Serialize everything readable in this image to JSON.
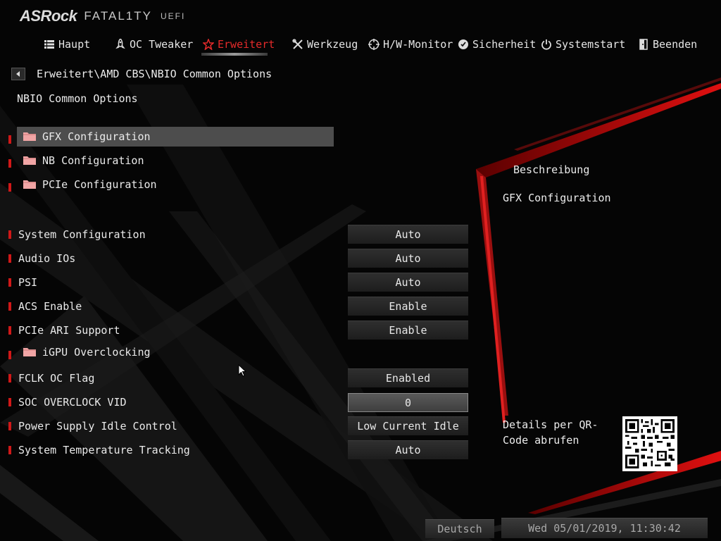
{
  "header": {
    "brand": "ASRock",
    "product": "FATAL1TY",
    "mode": "UEFI"
  },
  "nav": {
    "items": [
      {
        "label": "Haupt",
        "icon": "list-icon"
      },
      {
        "label": "OC Tweaker",
        "icon": "rocket-icon"
      },
      {
        "label": "Erweitert",
        "icon": "star-icon",
        "active": true
      },
      {
        "label": "Werkzeug",
        "icon": "tools-icon"
      },
      {
        "label": "H/W-Monitor",
        "icon": "crosshair-icon"
      },
      {
        "label": "Sicherheit",
        "icon": "shield-icon"
      },
      {
        "label": "Systemstart",
        "icon": "power-icon"
      },
      {
        "label": "Beenden",
        "icon": "exit-door-icon"
      }
    ]
  },
  "breadcrumb": "Erweitert\\AMD CBS\\NBIO Common Options",
  "page_title": "NBIO Common Options",
  "submenus": [
    {
      "label": "GFX Configuration",
      "selected": true
    },
    {
      "label": "NB Configuration"
    },
    {
      "label": "PCIe Configuration"
    }
  ],
  "settings": [
    {
      "label": "System Configuration",
      "value": "Auto"
    },
    {
      "label": "Audio IOs",
      "value": "Auto"
    },
    {
      "label": "PSI",
      "value": "Auto"
    },
    {
      "label": "ACS Enable",
      "value": "Enable"
    },
    {
      "label": "PCIe ARI Support",
      "value": "Enable"
    },
    {
      "label": "iGPU Overclocking",
      "submenu": true
    },
    {
      "label": "FCLK OC Flag",
      "value": "Enabled"
    },
    {
      "label": "SOC OVERCLOCK VID",
      "value": "0",
      "input": true
    },
    {
      "label": "Power Supply Idle Control",
      "value": "Low Current Idle"
    },
    {
      "label": "System Temperature Tracking",
      "value": "Auto"
    }
  ],
  "description": {
    "title": "Beschreibung",
    "text": "GFX Configuration",
    "qr_text": "Details per QR-Code abrufen"
  },
  "footer": {
    "language": "Deutsch",
    "datetime": "Wed 05/01/2019, 11:30:42"
  },
  "colors": {
    "accent": "#e52a2a",
    "marker": "#d01818",
    "highlight": "#4d4d4d"
  }
}
